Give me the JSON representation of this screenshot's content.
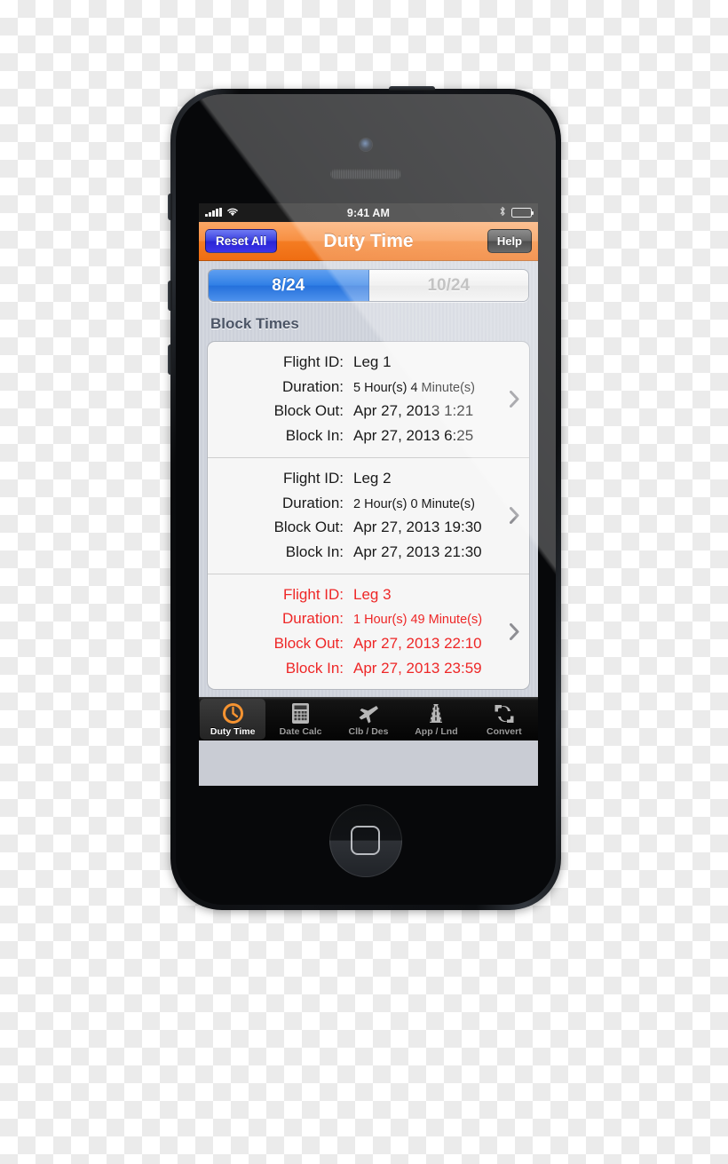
{
  "status_bar": {
    "signal_icon": "signal-bars-icon",
    "wifi_icon": "wifi-icon",
    "time": "9:41 AM",
    "bluetooth_icon": "bluetooth-icon",
    "battery_icon": "battery-icon"
  },
  "nav_bar": {
    "left_button": "Reset All",
    "title": "Duty Time",
    "right_button": "Help",
    "accent_color": "#f47c22"
  },
  "segmented_control": {
    "options": [
      {
        "label": "8/24",
        "selected": true
      },
      {
        "label": "10/24",
        "selected": false
      }
    ],
    "selected_color": "#2f7fe6"
  },
  "section": {
    "title": "Block Times"
  },
  "legs": [
    {
      "flight_id_label": "Flight ID:",
      "flight_id_value": "Leg 1",
      "duration_label": "Duration:",
      "duration_value": "5 Hour(s) 4 Minute(s)",
      "block_out_label": "Block Out:",
      "block_out_value": "Apr 27, 2013 1:21",
      "block_in_label": "Block In:",
      "block_in_value": "Apr 27, 2013 6:25",
      "alert": false,
      "disclosure_icon": "chevron-right-icon"
    },
    {
      "flight_id_label": "Flight ID:",
      "flight_id_value": "Leg 2",
      "duration_label": "Duration:",
      "duration_value": "2 Hour(s) 0 Minute(s)",
      "block_out_label": "Block Out:",
      "block_out_value": "Apr 27, 2013 19:30",
      "block_in_label": "Block In:",
      "block_in_value": "Apr 27, 2013 21:30",
      "alert": false,
      "disclosure_icon": "chevron-right-icon"
    },
    {
      "flight_id_label": "Flight ID:",
      "flight_id_value": "Leg 3",
      "duration_label": "Duration:",
      "duration_value": "1 Hour(s) 49 Minute(s)",
      "block_out_label": "Block Out:",
      "block_out_value": "Apr 27, 2013 22:10",
      "block_in_label": "Block In:",
      "block_in_value": "Apr 27, 2013 23:59",
      "alert": true,
      "alert_color": "#ee2727",
      "disclosure_icon": "chevron-right-icon"
    }
  ],
  "tab_bar": {
    "tabs": [
      {
        "label": "Duty Time",
        "icon": "clock-icon",
        "active": true
      },
      {
        "label": "Date Calc",
        "icon": "calculator-icon",
        "active": false
      },
      {
        "label": "Clb / Des",
        "icon": "airplane-climb-icon",
        "active": false
      },
      {
        "label": "App / Lnd",
        "icon": "runway-icon",
        "active": false
      },
      {
        "label": "Convert",
        "icon": "refresh-arrows-icon",
        "active": false
      }
    ],
    "active_icon_color": "#f59331"
  },
  "device": {
    "camera_icon": "front-camera-icon",
    "earpiece_icon": "earpiece-speaker-icon",
    "home_button_icon": "home-button-icon",
    "mute_switch": "mute-switch-button",
    "volume_up": "volume-up-button",
    "volume_down": "volume-down-button",
    "power": "power-button"
  }
}
